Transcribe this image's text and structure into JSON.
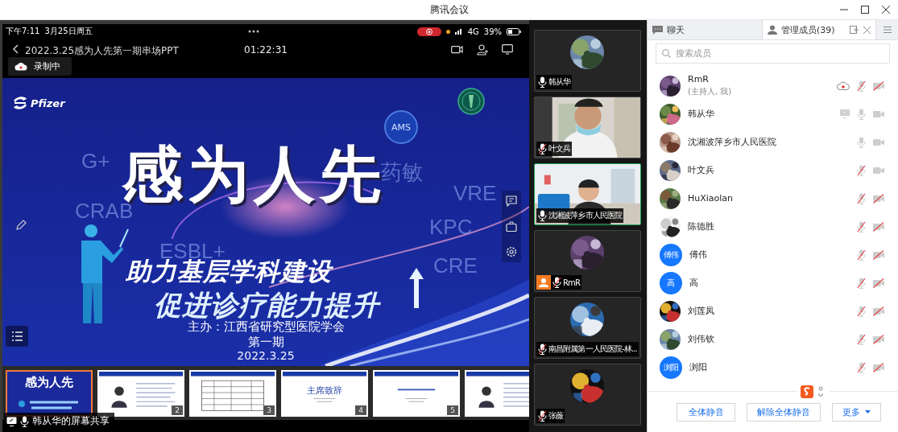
{
  "window": {
    "title": "腾讯会议"
  },
  "share": {
    "status_time": "下午7:11",
    "status_date": "3月25日周五",
    "network": "4G",
    "battery": "39%",
    "title": "2022.3.25感为人先第一期串场PPT",
    "elapsed": "01:22:31",
    "recording_label": "录制中",
    "owner_label": "韩从华的屏幕共享",
    "slide": {
      "logo": "Pfizer",
      "headline": "感为人先",
      "badge": "AMS",
      "tagline_1": "助力基层学科建设",
      "tagline_2": "促进诊疗能力提升",
      "organizer": "主办：江西省研究型医院学会",
      "issue": "第一期",
      "date": "2022.3.25",
      "background_words": [
        "G+",
        "CRAB",
        "药敏",
        "VRE",
        "ESBL+",
        "KPC",
        "CRE"
      ]
    },
    "thumbnails": [
      {
        "kind": "cover",
        "selected": true,
        "heading": "感为人先"
      },
      {
        "kind": "profile",
        "selected": false,
        "number": "2"
      },
      {
        "kind": "table",
        "selected": false,
        "number": "3"
      },
      {
        "kind": "title",
        "selected": false,
        "heading": "主席致辞",
        "number": "4"
      },
      {
        "kind": "title",
        "selected": false,
        "number": "5"
      },
      {
        "kind": "profile",
        "selected": false
      }
    ]
  },
  "videos": [
    {
      "name": "韩从华",
      "kind": "avatar",
      "mic_muted": false,
      "selected": false,
      "host": false
    },
    {
      "name": "叶文兵",
      "kind": "camera",
      "mic_muted": true,
      "selected": false,
      "host": false
    },
    {
      "name": "沈湘波萍乡市人民医院",
      "kind": "camera",
      "mic_muted": false,
      "selected": true,
      "host": false
    },
    {
      "name": "RmR",
      "kind": "avatar",
      "mic_muted": true,
      "selected": false,
      "host": true
    },
    {
      "name": "南昌附属第一人民医院-林...",
      "kind": "avatar",
      "mic_muted": true,
      "selected": false,
      "host": false
    },
    {
      "name": "张薇",
      "kind": "avatar",
      "mic_muted": true,
      "selected": false,
      "host": false
    }
  ],
  "panel": {
    "tabs": [
      {
        "label": "聊天",
        "selected": false
      },
      {
        "label": "管理成员(39)",
        "selected": true
      }
    ],
    "search": {
      "placeholder": "搜索成员"
    },
    "members": [
      {
        "name": "RmR",
        "note": "(主持人, 我)",
        "recording": true,
        "sharing": false,
        "mic_muted": true,
        "cam_muted": true
      },
      {
        "name": "韩从华",
        "recording": false,
        "sharing": true,
        "mic_muted": false,
        "cam_muted": false
      },
      {
        "name": "沈湘波萍乡市人民医院",
        "recording": false,
        "sharing": false,
        "mic_muted": false,
        "cam_muted": false
      },
      {
        "name": "叶文兵",
        "recording": false,
        "sharing": false,
        "mic_muted": true,
        "cam_muted": false
      },
      {
        "name": "HuXiaolan",
        "recording": false,
        "sharing": false,
        "mic_muted": true,
        "cam_muted": true
      },
      {
        "name": "陈德胜",
        "recording": false,
        "sharing": false,
        "mic_muted": true,
        "cam_muted": true
      },
      {
        "name": "傅伟",
        "avatar": {
          "kind": "initials",
          "text": "傅伟"
        },
        "recording": false,
        "sharing": false,
        "mic_muted": true,
        "cam_muted": true
      },
      {
        "name": "高",
        "avatar": {
          "kind": "initials",
          "text": "高"
        },
        "recording": false,
        "sharing": false,
        "mic_muted": true,
        "cam_muted": true
      },
      {
        "name": "刘莲凤",
        "recording": false,
        "sharing": false,
        "mic_muted": true,
        "cam_muted": true
      },
      {
        "name": "刘伟钦",
        "recording": false,
        "sharing": false,
        "mic_muted": true,
        "cam_muted": true
      },
      {
        "name": "浏阳",
        "avatar": {
          "kind": "initials",
          "text": "浏阳"
        },
        "recording": false,
        "sharing": false,
        "mic_muted": true,
        "cam_muted": true
      }
    ],
    "buttons": [
      "全体静音",
      "解除全体静音",
      "更多"
    ]
  }
}
